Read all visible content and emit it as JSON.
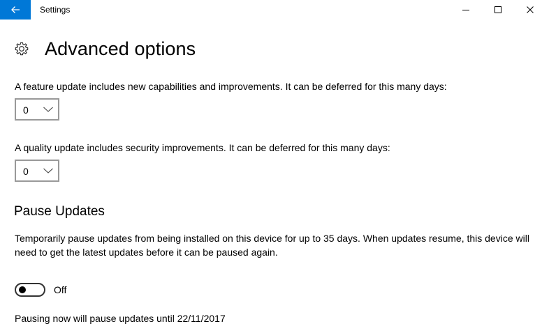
{
  "window": {
    "title": "Settings",
    "accent_color": "#0078d7",
    "controls": {
      "minimize_icon": "minimize-icon",
      "maximize_icon": "maximize-icon",
      "close_icon": "close-icon"
    }
  },
  "header": {
    "back_icon": "back-arrow-icon",
    "page_icon": "gear-icon",
    "title": "Advanced options"
  },
  "feature_update": {
    "label": "A feature update includes new capabilities and improvements. It can be deferred for this many days:",
    "selected_value": "0"
  },
  "quality_update": {
    "label": "A quality update includes security improvements. It can be deferred for this many days:",
    "selected_value": "0"
  },
  "pause_updates": {
    "heading": "Pause Updates",
    "description": "Temporarily pause updates from being installed on this device for up to 35 days. When updates resume, this device will need to get the latest updates before it can be paused again.",
    "toggle_state": "Off",
    "note": "Pausing now will pause updates until 22/11/2017"
  }
}
